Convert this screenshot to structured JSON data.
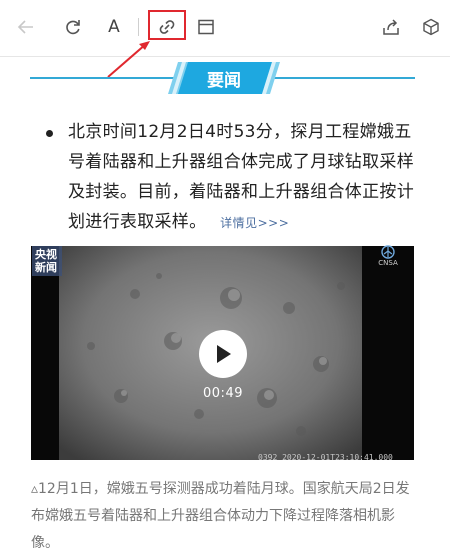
{
  "toolbar": {
    "icons": [
      "back-arrow-icon",
      "refresh-icon",
      "text-size-icon",
      "link-icon",
      "reader-icon",
      "share-icon",
      "cube-icon"
    ],
    "font_label": "A"
  },
  "section": {
    "title": "要闻"
  },
  "article": {
    "text": "北京时间12月2日4时53分，探月工程嫦娥五号着陆器和上升器组合体完成了月球钻取采样及封装。目前，着陆器和上升器组合体正按计划进行表取采样。",
    "more": "详情见>>>"
  },
  "video": {
    "logo": "央视新闻",
    "duration": "00:49",
    "timestamp": "0392  2020-12-01T23:10:41.000",
    "badge": "CNSA"
  },
  "caption": "▵12月1日，嫦娥五号探测器成功着陆月球。国家航天局2日发布嫦娥五号着陆器和上升器组合体动力下降过程降落相机影像。",
  "colors": {
    "accent": "#33a9d6",
    "highlight": "#e0282f",
    "link": "#4d6fa0"
  }
}
